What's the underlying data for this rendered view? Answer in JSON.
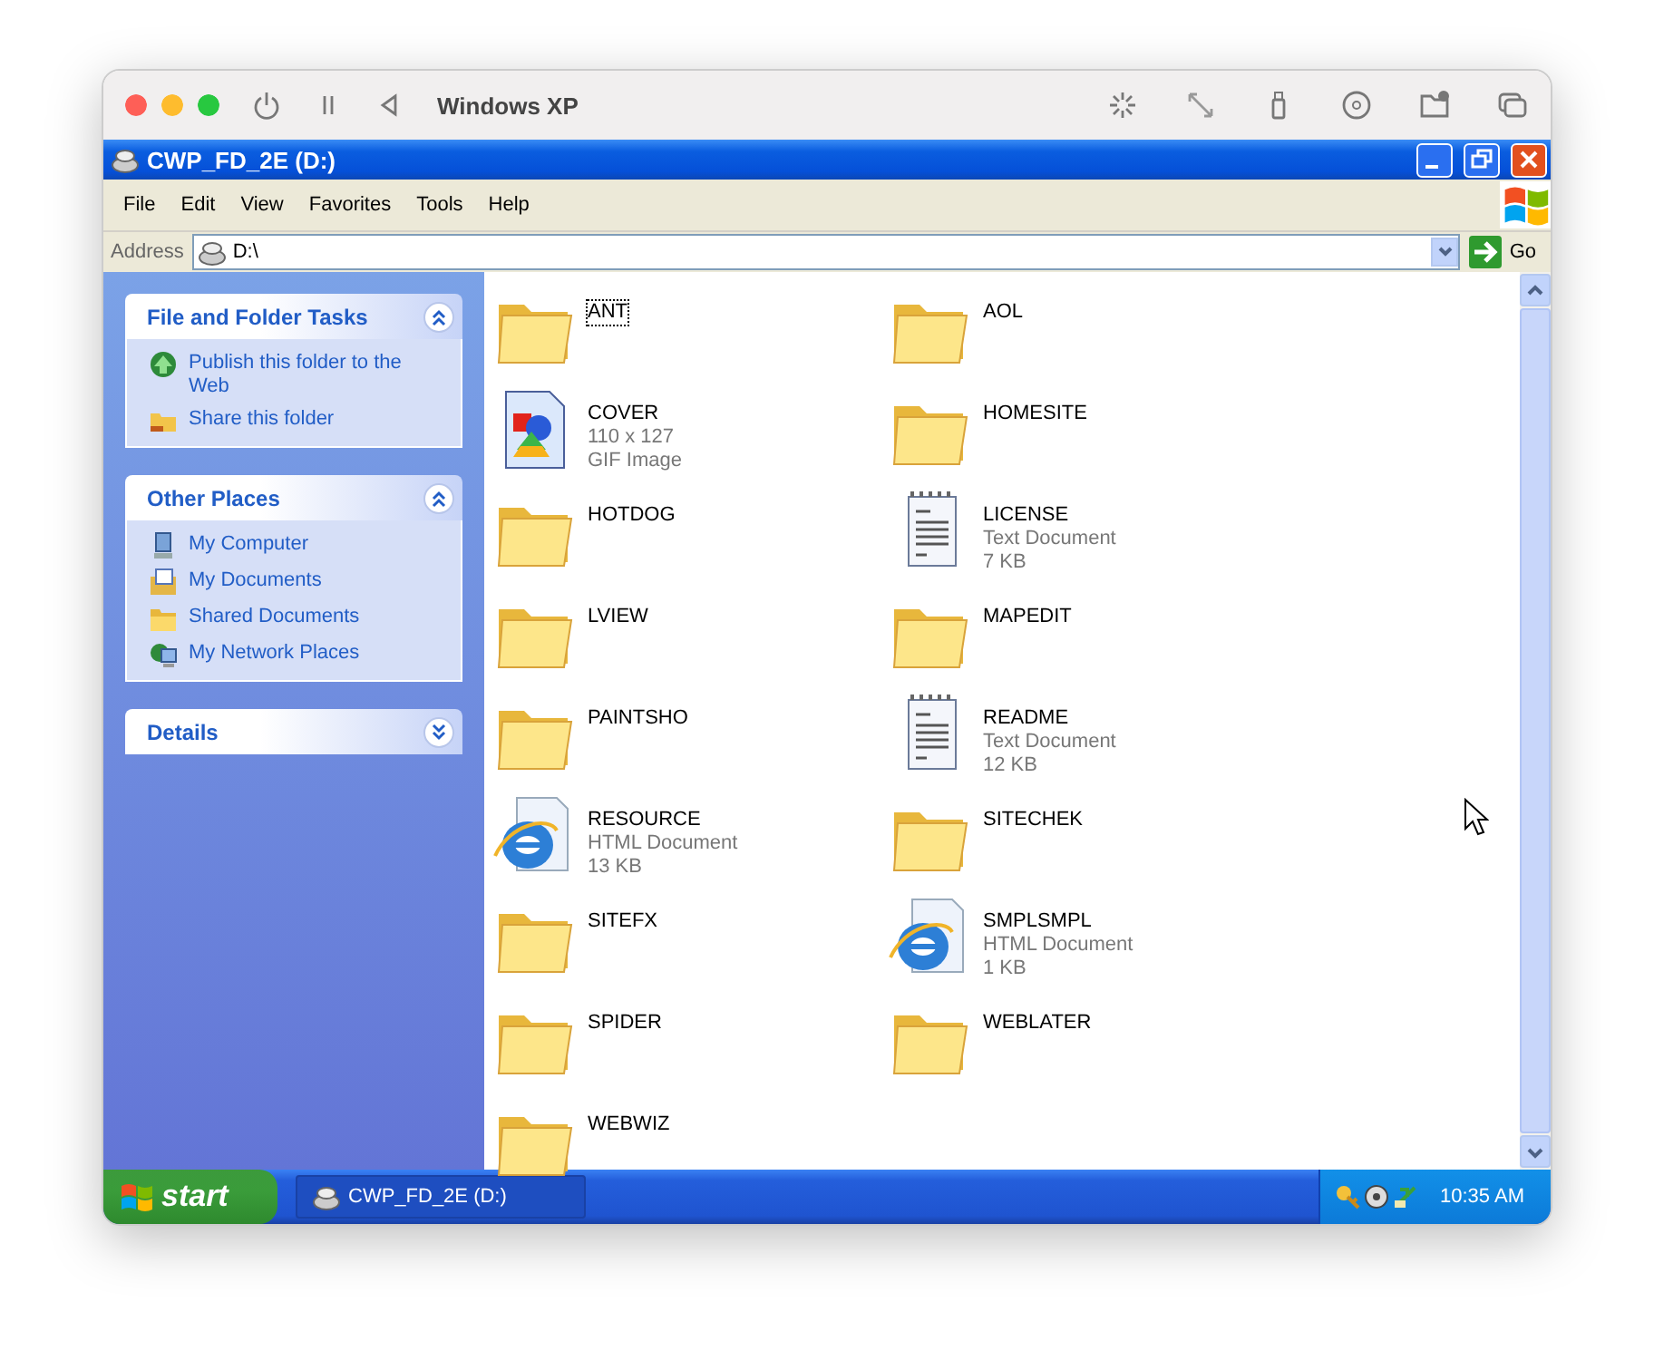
{
  "host_window": {
    "title": "Windows XP"
  },
  "window": {
    "title": "CWP_FD_2E (D:)"
  },
  "menu": [
    "File",
    "Edit",
    "View",
    "Favorites",
    "Tools",
    "Help"
  ],
  "address": {
    "label": "Address",
    "value": "D:\\",
    "go": "Go"
  },
  "sidebar": {
    "panels": [
      {
        "title": "File and Folder Tasks",
        "expanded": true,
        "items": [
          {
            "label": "Publish this folder to the Web",
            "kind": "publish"
          },
          {
            "label": "Share this folder",
            "kind": "share"
          }
        ]
      },
      {
        "title": "Other Places",
        "expanded": true,
        "items": [
          {
            "label": "My Computer",
            "kind": "computer"
          },
          {
            "label": "My Documents",
            "kind": "documents"
          },
          {
            "label": "Shared Documents",
            "kind": "folder"
          },
          {
            "label": "My Network Places",
            "kind": "network"
          }
        ]
      },
      {
        "title": "Details",
        "expanded": false
      }
    ]
  },
  "files": [
    {
      "name": "ANT",
      "kind": "folder",
      "focused": true
    },
    {
      "name": "AOL",
      "kind": "folder",
      "focused": false
    },
    {
      "name": "COVER",
      "kind": "image",
      "details": [
        "110 x 127",
        "GIF Image"
      ],
      "focused": false
    },
    {
      "name": "HOMESITE",
      "kind": "folder",
      "focused": false
    },
    {
      "name": "HOTDOG",
      "kind": "folder",
      "focused": false
    },
    {
      "name": "LICENSE",
      "kind": "text",
      "details": [
        "Text Document",
        "7 KB"
      ],
      "focused": false
    },
    {
      "name": "LVIEW",
      "kind": "folder",
      "focused": false
    },
    {
      "name": "MAPEDIT",
      "kind": "folder",
      "focused": false
    },
    {
      "name": "PAINTSHO",
      "kind": "folder",
      "focused": false
    },
    {
      "name": "README",
      "kind": "text",
      "details": [
        "Text Document",
        "12 KB"
      ],
      "focused": false
    },
    {
      "name": "RESOURCE",
      "kind": "html",
      "details": [
        "HTML Document",
        "13 KB"
      ],
      "focused": false
    },
    {
      "name": "SITECHEK",
      "kind": "folder",
      "focused": false
    },
    {
      "name": "SITEFX",
      "kind": "folder",
      "focused": false
    },
    {
      "name": "SMPLSMPL",
      "kind": "html",
      "details": [
        "HTML Document",
        "1 KB"
      ],
      "focused": false
    },
    {
      "name": "SPIDER",
      "kind": "folder",
      "focused": false
    },
    {
      "name": "WEBLATER",
      "kind": "folder",
      "focused": false
    },
    {
      "name": "WEBWIZ",
      "kind": "folder",
      "focused": false
    }
  ],
  "taskbar": {
    "start": "start",
    "tasks": [
      {
        "label": "CWP_FD_2E (D:)",
        "selected": true
      }
    ],
    "clock": "10:35 AM"
  }
}
